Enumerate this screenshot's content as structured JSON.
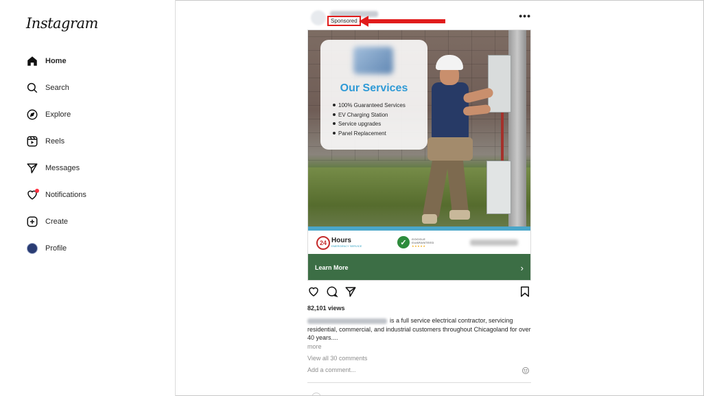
{
  "app": {
    "name": "Instagram"
  },
  "sidebar": {
    "items": [
      {
        "label": "Home",
        "icon": "home-icon",
        "active": true
      },
      {
        "label": "Search",
        "icon": "search-icon",
        "active": false
      },
      {
        "label": "Explore",
        "icon": "compass-icon",
        "active": false
      },
      {
        "label": "Reels",
        "icon": "reels-icon",
        "active": false
      },
      {
        "label": "Messages",
        "icon": "paper-plane-icon",
        "active": false
      },
      {
        "label": "Notifications",
        "icon": "heart-icon",
        "active": false
      },
      {
        "label": "Create",
        "icon": "plus-square-icon",
        "active": false
      },
      {
        "label": "Profile",
        "icon": "avatar",
        "active": false
      }
    ]
  },
  "post": {
    "sponsored_label": "Sponsored",
    "ad": {
      "services_title": "Our Services",
      "services": [
        "100% Guaranteed Services",
        "EV Charging Station",
        "Service upgrades",
        "Panel Replacement"
      ],
      "hours_badge": {
        "number": "24",
        "label": "Hours",
        "sub": "EMERGENCY SERVICE"
      },
      "google_badge": {
        "line1": "GOOGLE",
        "line2": "GUARANTEED"
      },
      "cta_label": "Learn More"
    },
    "views": "82,101 views",
    "caption": "is a full service electrical contractor, servicing residential, commercial, and industrial customers throughout Chicagoland for over 40 years....",
    "more_label": "more",
    "view_comments_label": "View all 30 comments",
    "add_comment_placeholder": "Add a comment..."
  },
  "colors": {
    "annotation_red": "#e11b1b",
    "services_blue": "#2f9ad6",
    "cta_green": "#3c6e45",
    "notification_dot": "#ff3040"
  }
}
